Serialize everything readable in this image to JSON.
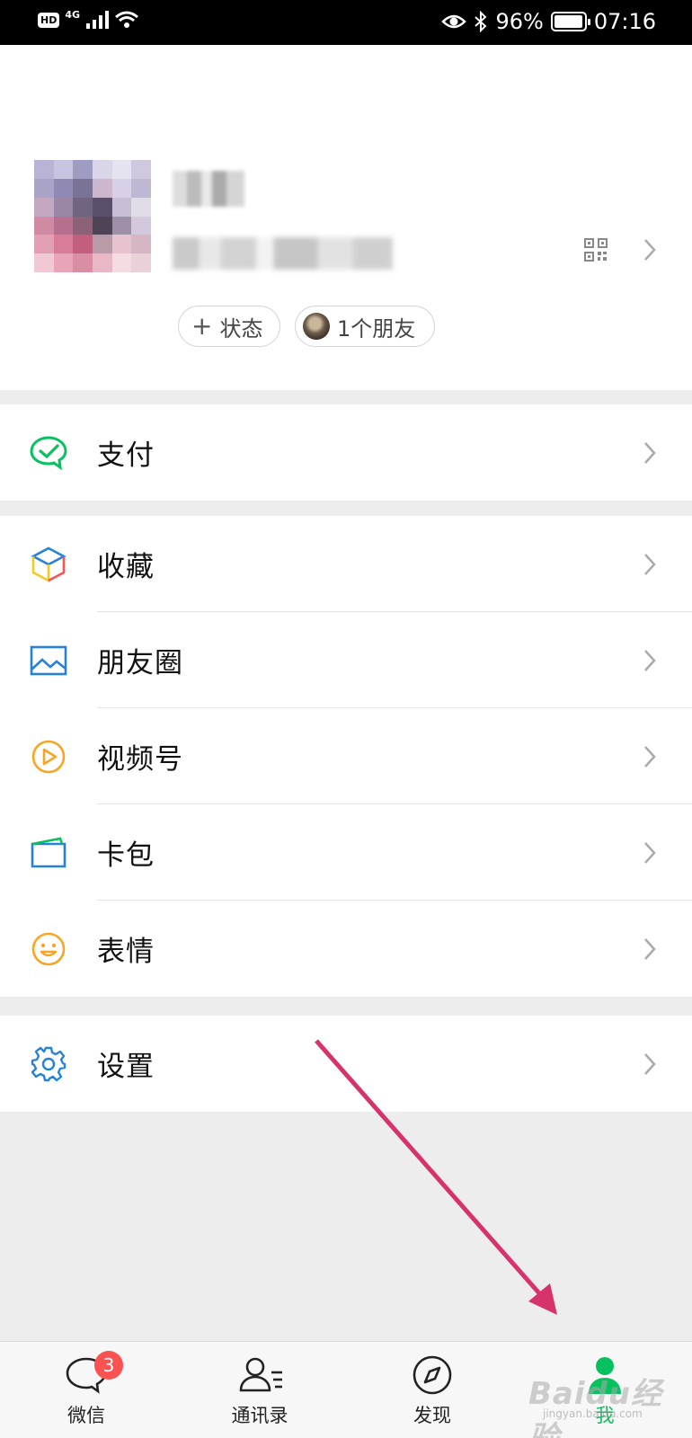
{
  "status_bar": {
    "hd": "HD",
    "network": "4G",
    "battery_text": "96%",
    "battery_level": 0.96,
    "time": "07:16"
  },
  "profile": {
    "qr_icon": "qr-code-icon",
    "status_pill": {
      "icon": "plus-icon",
      "label": "状态"
    },
    "friends_pill": {
      "label": "1个朋友"
    }
  },
  "menu": {
    "pay": {
      "label": "支付",
      "icon": "wechat-pay-icon",
      "color": "#07c160"
    },
    "favorites": {
      "label": "收藏",
      "icon": "cube-icon"
    },
    "moments": {
      "label": "朋友圈",
      "icon": "image-icon",
      "color": "#2782d7"
    },
    "channels": {
      "label": "视频号",
      "icon": "play-circle-icon",
      "color": "#f6a623"
    },
    "cards": {
      "label": "卡包",
      "icon": "card-icon",
      "color": "#2782d7"
    },
    "stickers": {
      "label": "表情",
      "icon": "smiley-icon",
      "color": "#f6a623"
    },
    "settings": {
      "label": "设置",
      "icon": "gear-icon",
      "color": "#2782d7"
    }
  },
  "tabbar": {
    "chats": {
      "label": "微信",
      "badge": "3",
      "icon": "chat-bubble-icon"
    },
    "contacts": {
      "label": "通讯录",
      "icon": "contacts-icon"
    },
    "discover": {
      "label": "发现",
      "icon": "compass-icon"
    },
    "me": {
      "label": "我",
      "icon": "person-icon",
      "active": true
    }
  },
  "colors": {
    "accent": "#07c160",
    "badge": "#fa5151",
    "annotation_arrow": "#d6336c"
  },
  "watermark": {
    "text": "Baidu经验",
    "sub": "jingyan.baidu.com"
  }
}
